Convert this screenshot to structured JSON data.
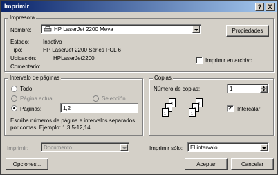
{
  "window": {
    "title": "Imprimir",
    "help_btn": "?",
    "close_btn": "X"
  },
  "printer_group": {
    "label": "Impresora",
    "name_label": "Nombre:",
    "name_value": "HP LaserJet 2200 Meva",
    "properties_button": "Propiedades",
    "status_label": "Estado:",
    "status_value": "Inactivo",
    "type_label": "Tipo:",
    "type_value": "HP LaserJet 2200 Series PCL 6",
    "location_label": "Ubicación:",
    "location_value": "HPLaserJet2200",
    "comment_label": "Comentario:",
    "print_to_file_label": "Imprimir en archivo",
    "print_to_file_checked": false
  },
  "range_group": {
    "label": "Intervalo de páginas",
    "all_label": "Todo",
    "current_label": "Página actual",
    "selection_label": "Selección",
    "pages_label": "Páginas:",
    "pages_value": "1,2",
    "selected": "pages",
    "hint_line1": "Escriba números de página e intervalos separados",
    "hint_line2": "por comas. Ejemplo: 1,3,5-12,14"
  },
  "copies_group": {
    "label": "Copias",
    "copies_label": "Número de copias:",
    "copies_value": "1",
    "collate_label": "Intercalar",
    "collate_checked": true,
    "page_numbers": [
      "1",
      "2",
      "3"
    ]
  },
  "bottom": {
    "print_what_label": "Imprimir:",
    "print_what_value": "Documento",
    "print_only_label": "Imprimir sólo:",
    "print_only_value": "El intervalo",
    "options_button": "Opciones...",
    "ok_button": "Aceptar",
    "cancel_button": "Cancelar"
  }
}
